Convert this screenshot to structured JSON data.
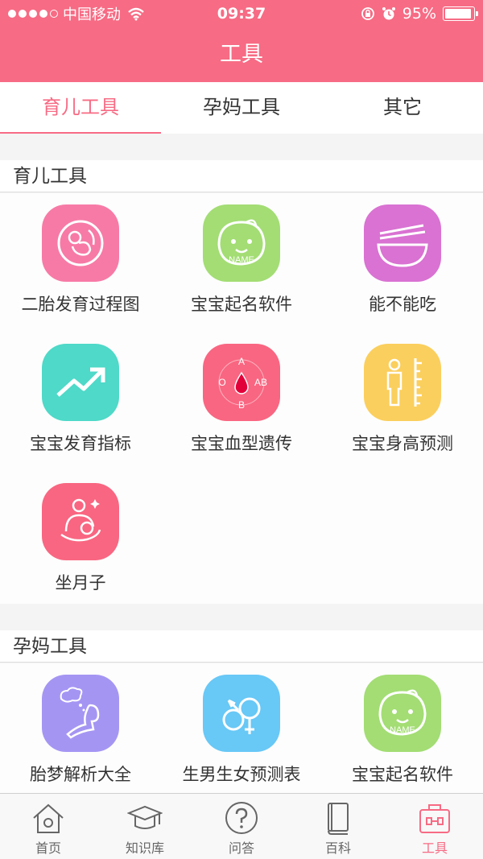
{
  "status_bar": {
    "carrier": "中国移动",
    "time": "09:37",
    "battery": "95%",
    "battery_level": 0.95
  },
  "header": {
    "title": "工具"
  },
  "tabs": [
    {
      "label": "育儿工具",
      "active": true
    },
    {
      "label": "孕妈工具",
      "active": false
    },
    {
      "label": "其它",
      "active": false
    }
  ],
  "sections": [
    {
      "title": "育儿工具",
      "tools": [
        {
          "label": "二胎发育过程图",
          "icon": "fetus-icon",
          "color": "#f77aa6"
        },
        {
          "label": "宝宝起名软件",
          "icon": "baby-name-icon",
          "color": "#a3dd74",
          "icon_text": "NAME"
        },
        {
          "label": "能不能吃",
          "icon": "bowl-chopsticks-icon",
          "color": "#d972d2"
        },
        {
          "label": "宝宝发育指标",
          "icon": "trend-up-icon",
          "color": "#4ed9c8"
        },
        {
          "label": "宝宝血型遗传",
          "icon": "blood-type-icon",
          "color": "#f96681",
          "icon_text": {
            "a": "A",
            "o": "O",
            "ab": "AB",
            "b": "B"
          }
        },
        {
          "label": "宝宝身高预测",
          "icon": "height-ruler-icon",
          "color": "#fbcf5d"
        },
        {
          "label": "坐月子",
          "icon": "mother-baby-icon",
          "color": "#f96681"
        }
      ]
    },
    {
      "title": "孕妈工具",
      "tools": [
        {
          "label": "胎梦解析大全",
          "icon": "dream-icon",
          "color": "#a595f3"
        },
        {
          "label": "生男生女预测表",
          "icon": "gender-icon",
          "color": "#68c8f6"
        },
        {
          "label": "宝宝起名软件",
          "icon": "baby-name-icon",
          "color": "#a3dd74",
          "icon_text": "NAME"
        }
      ]
    }
  ],
  "bottom_nav": [
    {
      "label": "首页",
      "icon": "home-icon",
      "active": false
    },
    {
      "label": "知识库",
      "icon": "graduation-cap-icon",
      "active": false
    },
    {
      "label": "问答",
      "icon": "question-icon",
      "active": false
    },
    {
      "label": "百科",
      "icon": "book-icon",
      "active": false
    },
    {
      "label": "工具",
      "icon": "toolbox-icon",
      "active": true
    }
  ],
  "colors": {
    "accent": "#f76b84"
  }
}
